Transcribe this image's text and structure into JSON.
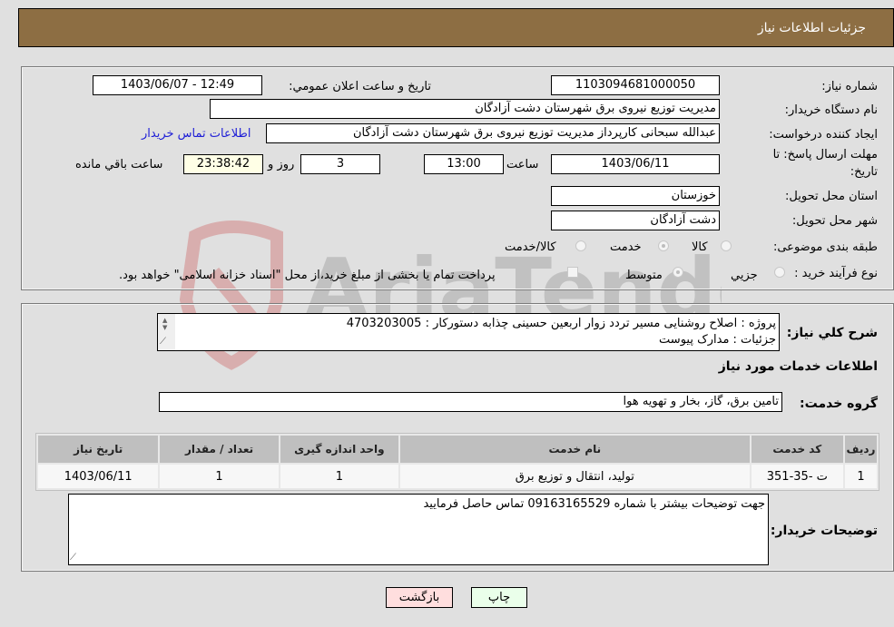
{
  "header": {
    "title": "جزئیات اطلاعات نیاز"
  },
  "details": {
    "need_number": {
      "label": "شماره نیاز:",
      "value": "1103094681000050"
    },
    "announce_datetime": {
      "label": "تاریخ و ساعت اعلان عمومي:",
      "value": "1403/06/07 - 12:49"
    },
    "buyer_org": {
      "label": "نام دستگاه خریدار:",
      "value": "مدیریت توزیع نیروی برق شهرستان دشت آزادگان"
    },
    "requester": {
      "label": "ایجاد کننده درخواست:",
      "value": "عبدالله سبحانی کارپرداز مدیریت توزیع نیروی برق شهرستان دشت آزادگان"
    },
    "buyer_contact_link": "اطلاعات تماس خریدار",
    "deadline": {
      "label": "مهلت ارسال پاسخ: تا تاریخ:",
      "date": "1403/06/11",
      "time_label": "ساعت",
      "time": "13:00",
      "days": "3",
      "days_label": "روز و",
      "remaining": "23:38:42",
      "remaining_label": "ساعت باقي مانده"
    },
    "province": {
      "label": "استان محل تحویل:",
      "value": "خوزستان"
    },
    "city": {
      "label": "شهر محل تحویل:",
      "value": "دشت آزادگان"
    },
    "category": {
      "label": "طبقه بندی موضوعی:",
      "options": [
        "کالا",
        "خدمت",
        "کالا/خدمت"
      ],
      "selected": "خدمت"
    },
    "purchase_type": {
      "label": "نوع فرآیند خرید :",
      "options": [
        "جزيي",
        "متوسط"
      ],
      "selected": "متوسط",
      "treasury_note": "پرداخت تمام یا بخشی از مبلغ خرید،از محل \"اسناد خزانه اسلامی\" خواهد بود."
    }
  },
  "description": {
    "label": "شرح کلي نیاز:",
    "line1": "پروژه :  اصلاح روشنایی مسیر تردد زوار اربعین حسینی چذابه دستورکار : 4703203005",
    "line2": "جزئیات : مدارک پیوست"
  },
  "services": {
    "section_title": "اطلاعات خدمات مورد نیاز",
    "group_label": "گروه خدمت:",
    "group_value": "تامین برق، گاز، بخار و تهویه هوا",
    "table": {
      "headers": [
        "ردیف",
        "کد خدمت",
        "نام خدمت",
        "واحد اندازه گیری",
        "تعداد / مقدار",
        "تاریخ نیاز"
      ],
      "rows": [
        [
          "1",
          "ت -35-351",
          "تولید، انتقال و توزیع برق",
          "1",
          "1",
          "1403/06/11"
        ]
      ]
    }
  },
  "buyer_notes": {
    "label": "توضیحات خریدار:",
    "value": "جهت توضیحات بیشتر با شماره 09163165529 تماس حاصل فرمایید"
  },
  "buttons": {
    "print": "چاپ",
    "back": "بازگشت"
  },
  "colors": {
    "header_bg": "#8d6e43",
    "print_bg": "#eaffea",
    "back_bg": "#ffdede",
    "link": "#1d1dd6"
  },
  "watermark": {
    "text": "AriaTender.neT"
  }
}
